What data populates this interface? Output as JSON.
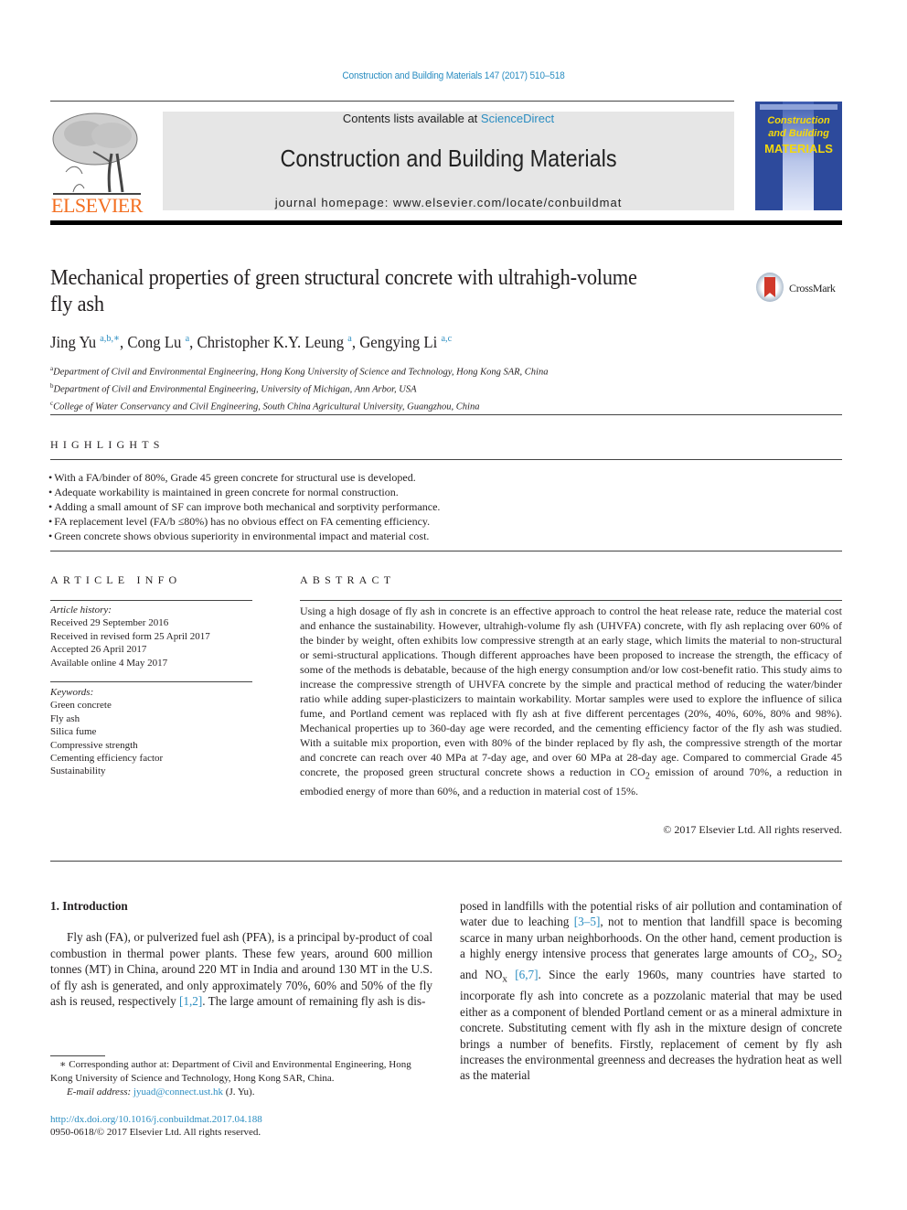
{
  "header": {
    "citation": "Construction and Building Materials 147 (2017) 510–518",
    "contents_prefix": "Contents lists available at ",
    "contents_link": "ScienceDirect",
    "journal_title": "Construction and Building Materials",
    "homepage": "journal homepage: www.elsevier.com/locate/conbuildmat",
    "publisher_logo_text": "ELSEVIER",
    "cover": {
      "title_line1": "Construction",
      "title_line2": "and Building",
      "title_line3": "MATERIALS",
      "bg_color": "#2d4a9c",
      "title_color": "#f5d90a"
    }
  },
  "article": {
    "title": "Mechanical properties of green structural concrete with ultrahigh-volume fly ash",
    "crossmark_label": "CrossMark",
    "authors": [
      {
        "name": "Jing Yu",
        "sup": "a,b,∗"
      },
      {
        "name": "Cong Lu",
        "sup": "a"
      },
      {
        "name": "Christopher K.Y. Leung",
        "sup": "a"
      },
      {
        "name": "Gengying Li",
        "sup": "a,c"
      }
    ],
    "affiliations": [
      {
        "sup": "a",
        "text": "Department of Civil and Environmental Engineering, Hong Kong University of Science and Technology, Hong Kong SAR, China"
      },
      {
        "sup": "b",
        "text": "Department of Civil and Environmental Engineering, University of Michigan, Ann Arbor, USA"
      },
      {
        "sup": "c",
        "text": "College of Water Conservancy and Civil Engineering, South China Agricultural University, Guangzhou, China"
      }
    ]
  },
  "highlights": {
    "heading": "HIGHLIGHTS",
    "items": [
      "With a FA/binder of 80%, Grade 45 green concrete for structural use is developed.",
      "Adequate workability is maintained in green concrete for normal construction.",
      "Adding a small amount of SF can improve both mechanical and sorptivity performance.",
      "FA replacement level (FA/b ≤80%) has no obvious effect on FA cementing efficiency.",
      "Green concrete shows obvious superiority in environmental impact and material cost."
    ]
  },
  "article_info": {
    "heading": "ARTICLE INFO",
    "history_label": "Article history:",
    "history": [
      "Received 29 September 2016",
      "Received in revised form 25 April 2017",
      "Accepted 26 April 2017",
      "Available online 4 May 2017"
    ],
    "keywords_label": "Keywords:",
    "keywords": [
      "Green concrete",
      "Fly ash",
      "Silica fume",
      "Compressive strength",
      "Cementing efficiency factor",
      "Sustainability"
    ]
  },
  "abstract": {
    "heading": "ABSTRACT",
    "text_part1": "Using a high dosage of fly ash in concrete is an effective approach to control the heat release rate, reduce the material cost and enhance the sustainability. However, ultrahigh-volume fly ash (UHVFA) concrete, with fly ash replacing over 60% of the binder by weight, often exhibits low compressive strength at an early stage, which limits the material to non-structural or semi-structural applications. Though different approaches have been proposed to increase the strength, the efficacy of some of the methods is debatable, because of the high energy consumption and/or low cost-benefit ratio. This study aims to increase the compressive strength of UHVFA concrete by the simple and practical method of reducing the water/binder ratio while adding super-plasticizers to maintain workability. Mortar samples were used to explore the influence of silica fume, and Portland cement was replaced with fly ash at five different percentages (20%, 40%, 60%, 80% and 98%). Mechanical properties up to 360-day age were recorded, and the cementing efficiency factor of the fly ash was studied. With a suitable mix proportion, even with 80% of the binder replaced by fly ash, the compressive strength of the mortar and concrete can reach over 40 MPa at 7-day age, and over 60 MPa at 28-day age. Compared to commercial Grade 45 concrete, the proposed green structural concrete shows a reduction in CO",
    "text_sub": "2",
    "text_part2": " emission of around 70%, a reduction in embodied energy of more than 60%, and a reduction in material cost of 15%.",
    "copyright": "© 2017 Elsevier Ltd. All rights reserved."
  },
  "introduction": {
    "heading": "1. Introduction",
    "left_p1_a": "Fly ash (FA), or pulverized fuel ash (PFA), is a principal by-product of coal combustion in thermal power plants. These few years, around 600 million tonnes (MT) in China, around 220 MT in India and around 130 MT in the U.S. of fly ash is generated, and only approximately 70%, 60% and 50% of the fly ash is reused, respectively ",
    "ref_1": "[1,2]",
    "left_p1_b": ". The large amount of remaining fly ash is dis-",
    "right_a": "posed in landfills with the potential risks of air pollution and contamination of water due to leaching ",
    "ref_2": "[3–5]",
    "right_b": ", not to mention that landfill space is becoming scarce in many urban neighborhoods. On the other hand, cement production is a highly energy intensive process that generates large amounts of CO",
    "sub_co2": "2",
    "right_c": ", SO",
    "sub_so2": "2",
    "right_d": " and NO",
    "sub_nox": "x",
    "right_e": " ",
    "ref_3": "[6,7]",
    "right_f": ". Since the early 1960s, many countries have started to incorporate fly ash into concrete as a pozzolanic material that may be used either as a component of blended Portland cement or as a mineral admixture in concrete. Substituting cement with fly ash in the mixture design of concrete brings a number of benefits. Firstly, replacement of cement by fly ash increases the environmental greenness and decreases the hydration heat as well as the material"
  },
  "footnotes": {
    "corresponding": "∗ Corresponding author at: Department of Civil and Environmental Engineering, Hong Kong University of Science and Technology, Hong Kong SAR, China.",
    "email_label": "E-mail address: ",
    "email": "jyuad@connect.ust.hk",
    "email_suffix": " (J. Yu).",
    "doi": "http://dx.doi.org/10.1016/j.conbuildmat.2017.04.188",
    "issn": "0950-0618/© 2017 Elsevier Ltd. All rights reserved."
  },
  "colors": {
    "link": "#2a8dc1",
    "elsevier_orange": "#f36f21",
    "masthead_bg": "#e6e6e6"
  }
}
